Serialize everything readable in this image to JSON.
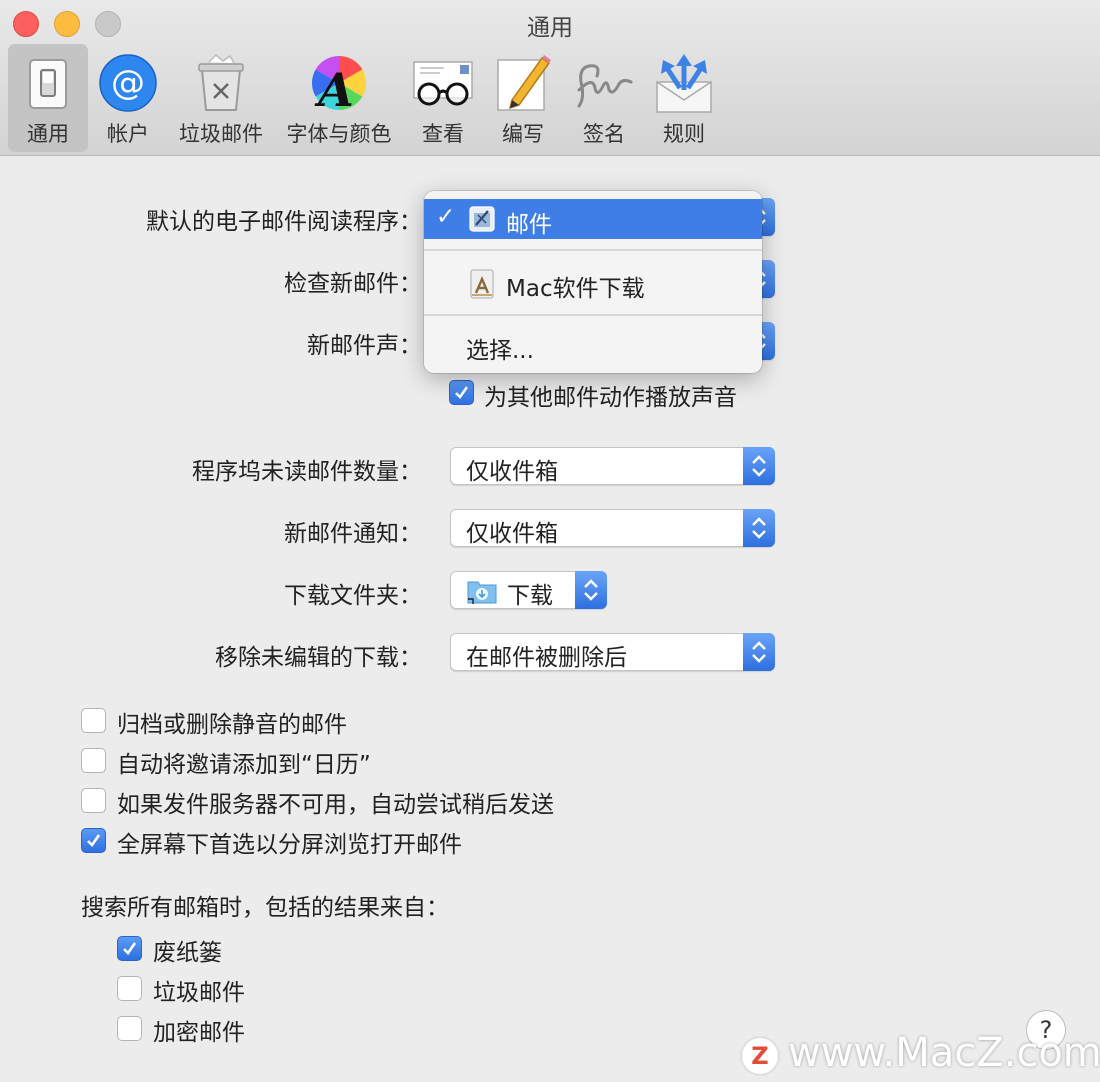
{
  "window": {
    "title": "通用"
  },
  "toolbar": {
    "items": [
      {
        "label": "通用",
        "icon": "switch-icon",
        "active": true
      },
      {
        "label": "帐户",
        "icon": "at-sign-icon"
      },
      {
        "label": "垃圾邮件",
        "icon": "trash-bin-icon"
      },
      {
        "label": "字体与颜色",
        "icon": "font-color-wheel-icon"
      },
      {
        "label": "查看",
        "icon": "glasses-icon"
      },
      {
        "label": "编写",
        "icon": "pencil-paper-icon"
      },
      {
        "label": "签名",
        "icon": "signature-icon"
      },
      {
        "label": "规则",
        "icon": "envelope-arrows-icon"
      }
    ]
  },
  "settings": {
    "default_reader_label": "默认的电子邮件阅读程序：",
    "check_mail_label": "检查新邮件：",
    "new_mail_sound_label": "新邮件声：",
    "play_sounds_label": "为其他邮件动作播放声音",
    "dock_unread_label": "程序坞未读邮件数量：",
    "dock_unread_value": "仅收件箱",
    "notifications_label": "新邮件通知：",
    "notifications_value": "仅收件箱",
    "downloads_folder_label": "下载文件夹：",
    "downloads_folder_value": "下载",
    "remove_downloads_label": "移除未编辑的下载：",
    "remove_downloads_value": "在邮件被删除后"
  },
  "dropdown": {
    "checkmark": "✓",
    "items": [
      {
        "label": "邮件"
      },
      {
        "label": "Mac软件下载"
      },
      {
        "label": "选择..."
      }
    ]
  },
  "options": {
    "archive_muted": "归档或删除静音的邮件",
    "add_invites": "自动将邀请添加到“日历”",
    "retry_send": "如果发件服务器不可用，自动尝试稍后发送",
    "split_view": "全屏幕下首选以分屏浏览打开邮件"
  },
  "search": {
    "heading": "搜索所有邮箱时，包括的结果来自：",
    "trash": "废纸篓",
    "junk": "垃圾邮件",
    "encrypted": "加密邮件"
  },
  "help": {
    "label": "?"
  },
  "watermark": {
    "logo": "Z",
    "text": "www.MacZ.com"
  },
  "colors": {
    "accent": "#3f7ee6",
    "stepper": "#2e6fe0"
  }
}
